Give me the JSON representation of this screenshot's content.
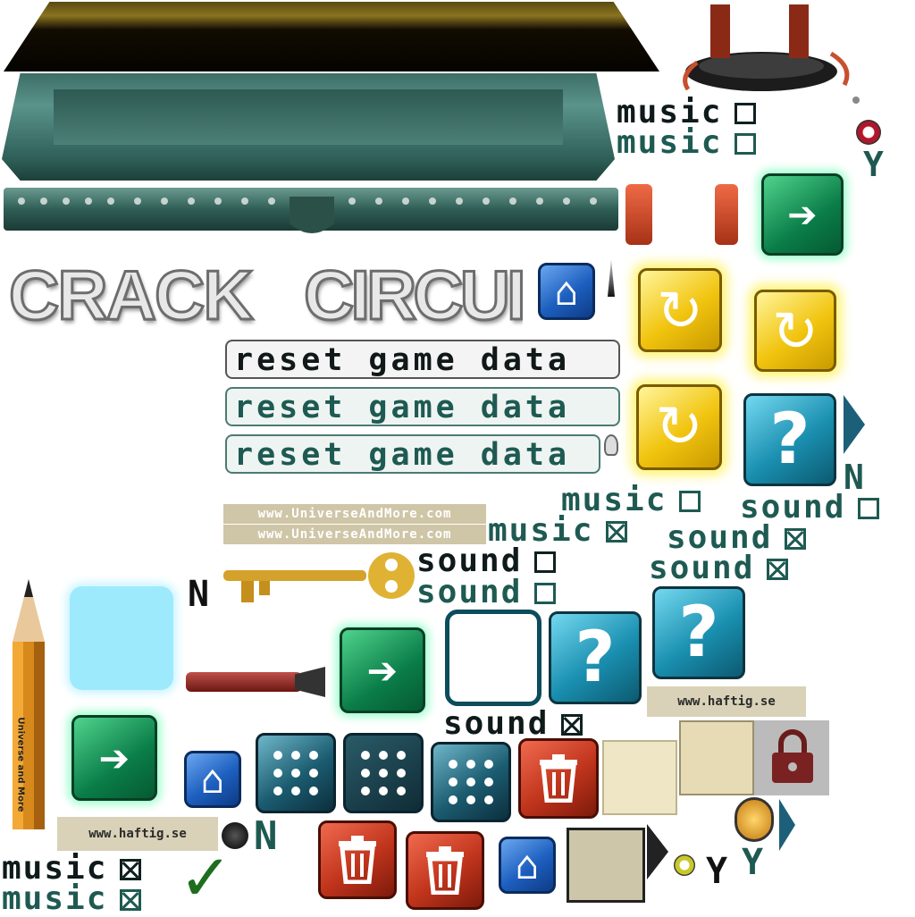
{
  "title_left": "CRACK",
  "title_right": "CIRCUIT",
  "reset_buttons": [
    "reset game data",
    "reset game data",
    "reset game data"
  ],
  "music": {
    "label": "music",
    "unchecked_box": "☐",
    "checked_box": "⊠"
  },
  "sound": {
    "label": "sound"
  },
  "letters": {
    "yes": "Y",
    "no": "N"
  },
  "watermark_universe": "www.UniverseAndMore.com",
  "watermark_haftig": "www.haftig.se",
  "pencil_text": "Universe and More",
  "icons": {
    "arrow": "➔",
    "question": "?",
    "home": "⌂",
    "refresh": "↻",
    "trash": "trash-icon",
    "lock": "lock-icon",
    "check": "✓"
  },
  "colors": {
    "green": "#0a7d48",
    "yellow": "#f1c40f",
    "teal": "#1a8fb0",
    "red": "#c0341c",
    "blue": "#1d5fbf",
    "label_teal": "#1e5a52",
    "label_dark": "#0f1a1a"
  }
}
